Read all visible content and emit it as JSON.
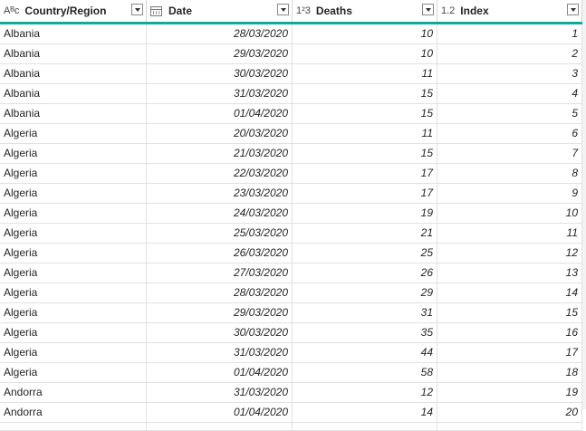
{
  "columns": [
    {
      "type_icon": "ABC",
      "type_label": "Aᴮc",
      "label": "Country/Region",
      "align": "left"
    },
    {
      "type_icon": "calendar",
      "type_label": "",
      "label": "Date",
      "align": "right"
    },
    {
      "type_icon": "whole-number",
      "type_label": "1²3",
      "label": "Deaths",
      "align": "right"
    },
    {
      "type_icon": "decimal",
      "type_label": "1.2",
      "label": "Index",
      "align": "right"
    }
  ],
  "rows": [
    [
      "Albania",
      "28/03/2020",
      "10",
      "1"
    ],
    [
      "Albania",
      "29/03/2020",
      "10",
      "2"
    ],
    [
      "Albania",
      "30/03/2020",
      "11",
      "3"
    ],
    [
      "Albania",
      "31/03/2020",
      "15",
      "4"
    ],
    [
      "Albania",
      "01/04/2020",
      "15",
      "5"
    ],
    [
      "Algeria",
      "20/03/2020",
      "11",
      "6"
    ],
    [
      "Algeria",
      "21/03/2020",
      "15",
      "7"
    ],
    [
      "Algeria",
      "22/03/2020",
      "17",
      "8"
    ],
    [
      "Algeria",
      "23/03/2020",
      "17",
      "9"
    ],
    [
      "Algeria",
      "24/03/2020",
      "19",
      "10"
    ],
    [
      "Algeria",
      "25/03/2020",
      "21",
      "11"
    ],
    [
      "Algeria",
      "26/03/2020",
      "25",
      "12"
    ],
    [
      "Algeria",
      "27/03/2020",
      "26",
      "13"
    ],
    [
      "Algeria",
      "28/03/2020",
      "29",
      "14"
    ],
    [
      "Algeria",
      "29/03/2020",
      "31",
      "15"
    ],
    [
      "Algeria",
      "30/03/2020",
      "35",
      "16"
    ],
    [
      "Algeria",
      "31/03/2020",
      "44",
      "17"
    ],
    [
      "Algeria",
      "01/04/2020",
      "58",
      "18"
    ],
    [
      "Andorra",
      "31/03/2020",
      "12",
      "19"
    ],
    [
      "Andorra",
      "01/04/2020",
      "14",
      "20"
    ]
  ],
  "colors": {
    "header_accent": "#13a89e",
    "gridline": "#e1e1e1"
  }
}
